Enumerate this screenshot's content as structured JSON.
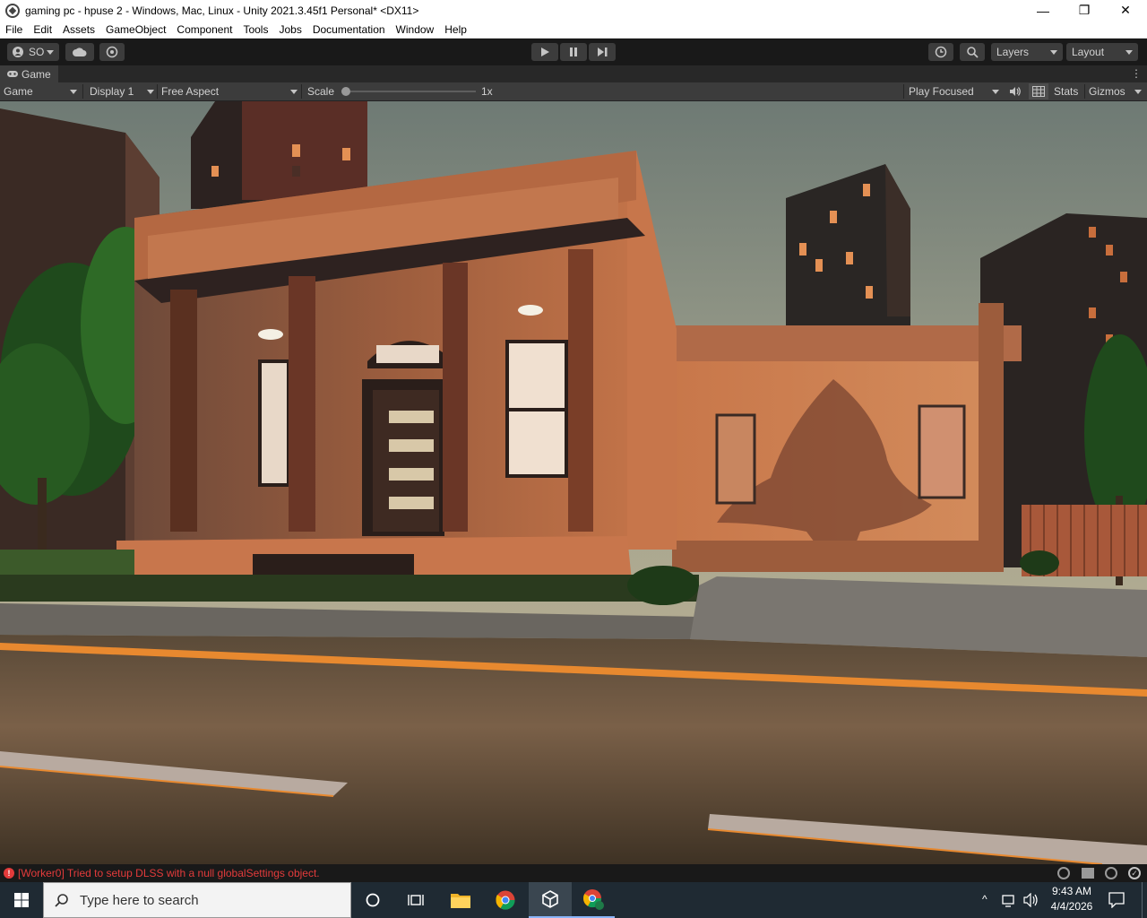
{
  "window": {
    "title": "gaming pc - hpuse 2 - Windows, Mac, Linux - Unity 2021.3.45f1 Personal* <DX11>",
    "controls": {
      "minimize": "—",
      "restore": "❐",
      "close": "✕"
    }
  },
  "menu": [
    "File",
    "Edit",
    "Assets",
    "GameObject",
    "Component",
    "Tools",
    "Jobs",
    "Documentation",
    "Window",
    "Help"
  ],
  "toolbar": {
    "account_label": "SO",
    "layers_label": "Layers",
    "layout_label": "Layout"
  },
  "game_tab": {
    "tab_label": "Game",
    "view_select": "Game",
    "display_select": "Display 1",
    "aspect_select": "Free Aspect",
    "scale_label": "Scale",
    "scale_value": "1x",
    "scale_fraction": 0.0,
    "play_mode_select": "Play Focused",
    "stats_label": "Stats",
    "gizmos_label": "Gizmos"
  },
  "status": {
    "error_message": "[Worker0] Tried to setup DLSS with a null globalSettings object."
  },
  "taskbar": {
    "search_placeholder": "Type here to search",
    "time": "9:43 AM",
    "date": "4/4/2026"
  },
  "colors": {
    "editor_bg": "#191919",
    "panel_bg": "#3c3c3c",
    "error_red": "#e33b3b",
    "taskbar_bg": "#1f2a33",
    "house_wall": "#b8673e",
    "road_line": "#e8892f"
  },
  "icons": [
    "unity-logo-icon",
    "account-icon",
    "cloud-icon",
    "collab-icon",
    "play-icon",
    "pause-icon",
    "step-icon",
    "history-icon",
    "search-icon",
    "kebab-icon",
    "mute-icon",
    "grid-icon",
    "error-icon",
    "windows-start-icon",
    "task-view-icon",
    "file-explorer-icon",
    "chrome-icon",
    "unity-icon",
    "chrome-profile-icon",
    "network-icon",
    "volume-icon",
    "notifications-icon"
  ]
}
